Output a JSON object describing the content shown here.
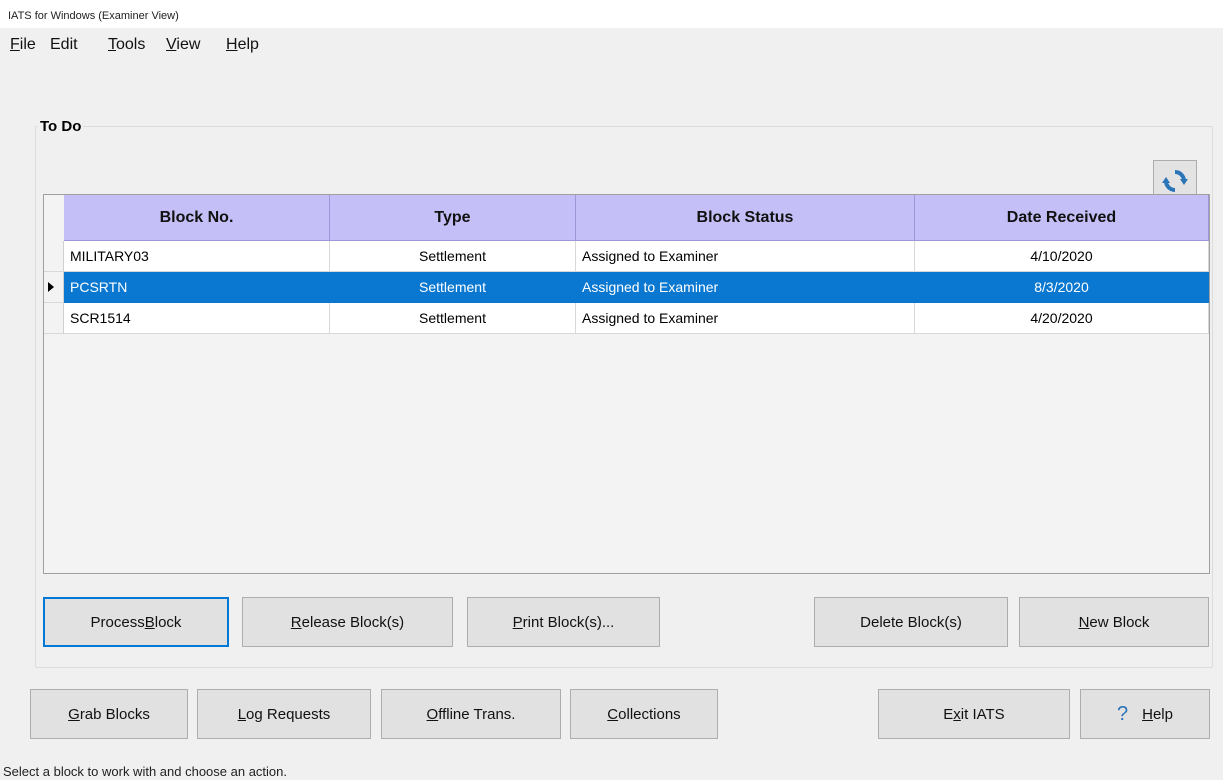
{
  "window": {
    "title": "IATS for Windows (Examiner View)"
  },
  "menu": [
    {
      "pre": "",
      "acc": "F",
      "post": "ile"
    },
    {
      "pre": "Edit",
      "acc": "",
      "post": ""
    },
    {
      "pre": "",
      "acc": "T",
      "post": "ools"
    },
    {
      "pre": "",
      "acc": "V",
      "post": "iew"
    },
    {
      "pre": "",
      "acc": "H",
      "post": "elp"
    }
  ],
  "group": {
    "title": "To Do"
  },
  "grid": {
    "columns": [
      "Block No.",
      "Type",
      "Block Status",
      "Date Received"
    ],
    "rows": [
      {
        "block": "MILITARY03",
        "type": "Settlement",
        "status": "Assigned to Examiner",
        "date": "4/10/2020"
      },
      {
        "block": "PCSRTN",
        "type": "Settlement",
        "status": "Assigned to Examiner",
        "date": "8/3/2020"
      },
      {
        "block": "SCR1514",
        "type": "Settlement",
        "status": "Assigned to Examiner",
        "date": "4/20/2020"
      }
    ],
    "selected_index": 1
  },
  "actions": [
    {
      "pre": "Process ",
      "acc": "B",
      "post": "lock"
    },
    {
      "pre": "",
      "acc": "R",
      "post": "elease Block(s)"
    },
    {
      "pre": "",
      "acc": "P",
      "post": "rint Block(s)..."
    },
    {
      "pre": "Delete Block(s)",
      "acc": "",
      "post": ""
    },
    {
      "pre": "",
      "acc": "N",
      "post": "ew Block"
    }
  ],
  "bottom": [
    {
      "pre": "",
      "acc": "G",
      "post": "rab Blocks"
    },
    {
      "pre": "",
      "acc": "L",
      "post": "og Requests"
    },
    {
      "pre": "",
      "acc": "O",
      "post": "ffline Trans."
    },
    {
      "pre": "",
      "acc": "C",
      "post": "ollections"
    },
    {
      "pre": "E",
      "acc": "x",
      "post": "it IATS"
    },
    {
      "pre": "",
      "acc": "H",
      "post": "elp"
    }
  ],
  "help_glyph": "?",
  "status": {
    "text": "Select a block to work with and choose an action."
  },
  "colors": {
    "header": "#c4c0f7",
    "selection": "#0a78d0",
    "default_border": "#0078d7"
  }
}
